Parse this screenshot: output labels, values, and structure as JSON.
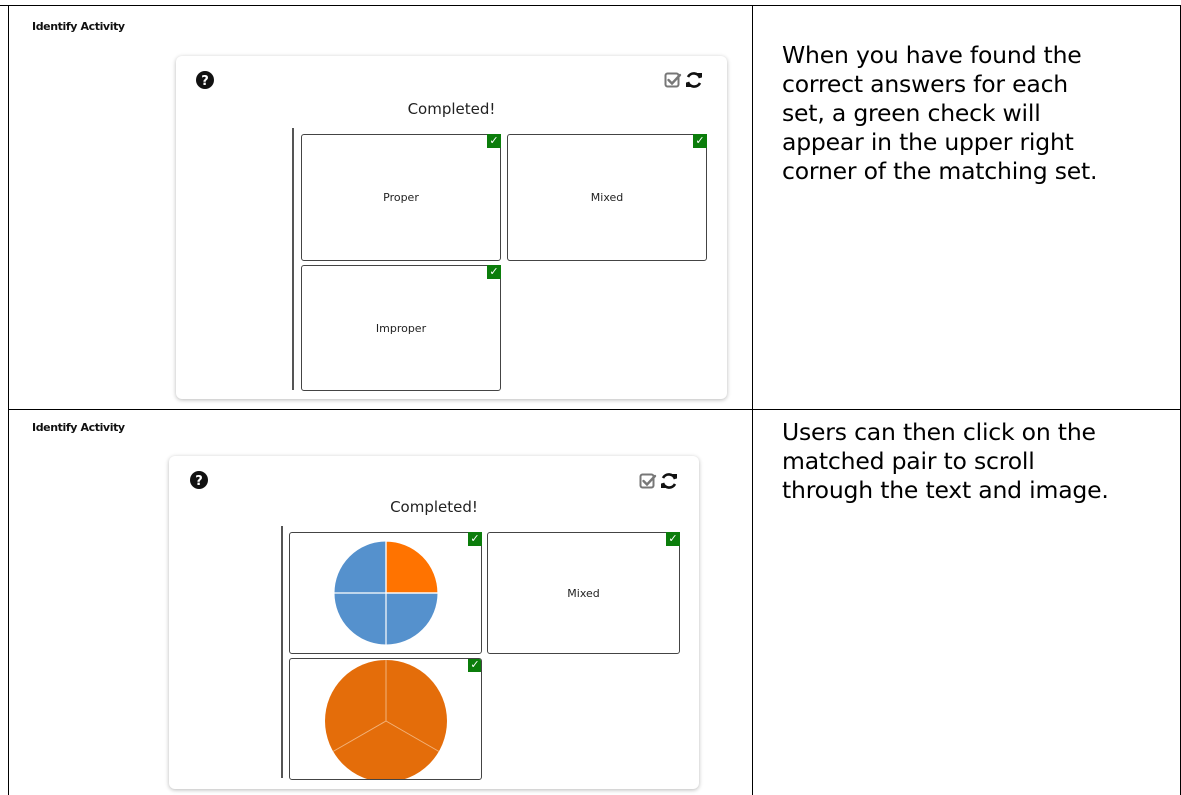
{
  "rows": [
    {
      "heading": "Identify Activity",
      "status": "Completed!",
      "description": "When you have found the\ncorrect answers for each\nset, a green check will\nappear in the upper right\ncorner of the matching set.",
      "tiles": [
        {
          "label": "Proper",
          "checked": true
        },
        {
          "label": "Mixed",
          "checked": true
        },
        {
          "label": "Improper",
          "checked": true
        }
      ]
    },
    {
      "heading": "Identify Activity",
      "status": "Completed!",
      "description": "Users can then click on the\nmatched pair to scroll\nthrough the text and image.",
      "tiles": [
        {
          "image": "pie-one-quarter-shaded",
          "checked": true
        },
        {
          "label": "Mixed",
          "checked": true
        },
        {
          "image": "pie-three-thirds-shaded",
          "checked": true
        }
      ]
    }
  ],
  "icons": {
    "help": "question-circle-icon",
    "check_answers": "check-square-icon",
    "reset": "refresh-icon",
    "tile_check": "✓"
  },
  "colors": {
    "check_green": "#0b7d0b",
    "pie_blue": "#5591cd",
    "pie_orange_quarter": "#ff7300",
    "pie_orange_full": "#e46d0a"
  }
}
